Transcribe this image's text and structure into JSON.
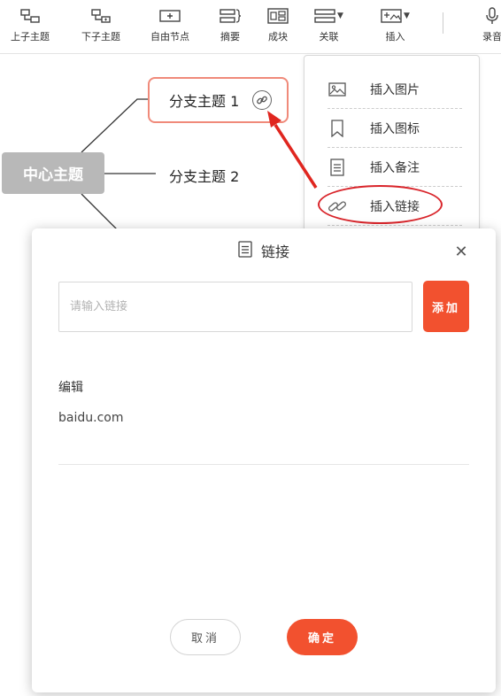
{
  "toolbar": {
    "items": [
      {
        "label": "上子主题",
        "icon": "parent-topic-icon"
      },
      {
        "label": "下子主题",
        "icon": "child-topic-icon"
      },
      {
        "label": "自由节点",
        "icon": "free-node-icon"
      },
      {
        "label": "摘要",
        "icon": "summary-icon"
      },
      {
        "label": "成块",
        "icon": "boundary-icon"
      },
      {
        "label": "关联",
        "icon": "relationship-icon"
      },
      {
        "label": "插入",
        "icon": "insert-icon"
      },
      {
        "label": "录音",
        "icon": "microphone-icon"
      }
    ]
  },
  "mindmap": {
    "center_topic": "中心主题",
    "branches": [
      "分支主题 1",
      "分支主题 2"
    ]
  },
  "insert_menu": {
    "items": [
      {
        "label": "插入图片",
        "icon": "image-icon"
      },
      {
        "label": "插入图标",
        "icon": "bookmark-icon"
      },
      {
        "label": "插入备注",
        "icon": "note-icon"
      },
      {
        "label": "插入链接",
        "icon": "link-icon"
      }
    ]
  },
  "dialog": {
    "title": "链接",
    "input": {
      "placeholder": "请输入链接",
      "value": ""
    },
    "add_label": "添加",
    "edit_label": "编辑",
    "current_link": "baidu.com",
    "cancel_label": "取消",
    "confirm_label": "确定"
  },
  "colors": {
    "accent": "#f2512f",
    "highlight": "#d9252b",
    "topic_border": "#f08a7a",
    "center_topic_bg": "#b8b8b8"
  }
}
